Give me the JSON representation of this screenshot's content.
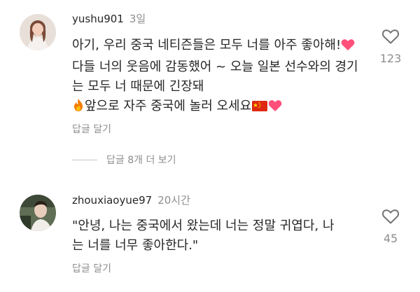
{
  "comments": [
    {
      "username": "yushu901",
      "time": "3일",
      "text_1": "아기, 우리 중국 네티즌들은 모두 너를 아주 좋아해!",
      "text_2": "다들 너의 웃음에 감동했어 ~ 오늘 일본 선수와의 경기는 모두 너 때문에 긴장돼",
      "text_3": "앞으로 자주 중국에 놀러 오세요",
      "reply_label": "답글 달기",
      "like_count": "123",
      "emojis": [
        "heart-emoji",
        "fire-emoji",
        "china-flag-emoji",
        "heart-emoji"
      ]
    },
    {
      "username": "zhouxiaoyue97",
      "time": "20시간",
      "text": "\"안녕, 나는 중국에서 왔는데 너는 정말 귀엽다, 나는 너를 너무 좋아한다.\"",
      "reply_label": "답글 달기",
      "like_count": "45"
    }
  ],
  "view_replies_label": "답글 8개 더 보기",
  "colors": {
    "text": "#262626",
    "secondary": "#8e8e8e",
    "heart": "#ff4f7b",
    "flag": "#de2910"
  }
}
